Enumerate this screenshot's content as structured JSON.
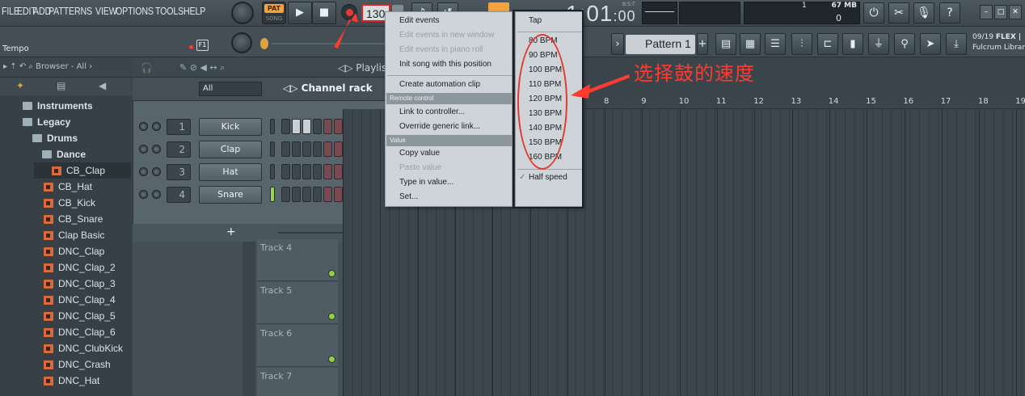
{
  "menu": [
    "FILE",
    "EDIT",
    "ADD",
    "PATTERNS",
    "VIEW",
    "OPTIONS",
    "TOOLS",
    "HELP"
  ],
  "transport": {
    "pat_label": "PAT",
    "song_label": "SONG",
    "play_icon": "play-icon",
    "stop_icon": "stop-icon",
    "tempo_value": "130",
    "time_main": "1:01",
    "time_sub": ":00",
    "bst_label": "B:S:T"
  },
  "memory": {
    "value": "67 MB",
    "count": "1",
    "count2": "0"
  },
  "hint_panel": {
    "date": "09/19",
    "title": "FLEX |",
    "line2": "Fulcrum Librar"
  },
  "bar2": {
    "tempo_label": "Tempo",
    "f1_label": "F1",
    "pattern_label": "Pattern 1"
  },
  "browser": {
    "header": "Browser - All",
    "items": [
      {
        "label": "Instruments",
        "type": "folder"
      },
      {
        "label": "Legacy",
        "type": "folder"
      },
      {
        "label": "Drums",
        "type": "folder"
      },
      {
        "label": "Dance",
        "type": "folder"
      },
      {
        "label": "CB_Clap",
        "type": "audio"
      },
      {
        "label": "CB_Hat",
        "type": "audio"
      },
      {
        "label": "CB_Kick",
        "type": "audio"
      },
      {
        "label": "CB_Snare",
        "type": "audio"
      },
      {
        "label": "Clap Basic",
        "type": "audio"
      },
      {
        "label": "DNC_Clap",
        "type": "audio"
      },
      {
        "label": "DNC_Clap_2",
        "type": "audio"
      },
      {
        "label": "DNC_Clap_3",
        "type": "audio"
      },
      {
        "label": "DNC_Clap_4",
        "type": "audio"
      },
      {
        "label": "DNC_Clap_5",
        "type": "audio"
      },
      {
        "label": "DNC_Clap_6",
        "type": "audio"
      },
      {
        "label": "DNC_ClubKick",
        "type": "audio"
      },
      {
        "label": "DNC_Crash",
        "type": "audio"
      },
      {
        "label": "DNC_Hat",
        "type": "audio"
      }
    ]
  },
  "channel_rack": {
    "title": "Channel rack",
    "filter": "All",
    "playlist_tab": "Playlist",
    "add_label": "+",
    "channels": [
      {
        "num": "1",
        "name": "Kick"
      },
      {
        "num": "2",
        "name": "Clap"
      },
      {
        "num": "3",
        "name": "Hat"
      },
      {
        "num": "4",
        "name": "Snare"
      }
    ]
  },
  "playlist": {
    "ruler": [
      "8",
      "9",
      "10",
      "11",
      "12",
      "13",
      "14",
      "15",
      "16",
      "17",
      "18",
      "19"
    ],
    "tracks": [
      "Track 4",
      "Track 5",
      "Track 6",
      "Track 7"
    ]
  },
  "context_menu": {
    "items": [
      {
        "label": "Edit events",
        "disabled": false
      },
      {
        "label": "Edit events in new window",
        "disabled": true
      },
      {
        "label": "Edit events in piano roll",
        "disabled": true
      },
      {
        "label": "Init song with this position",
        "disabled": false
      },
      {
        "label": "Create automation clip",
        "disabled": false
      }
    ],
    "header_remote": "Remote control",
    "remote_items": [
      {
        "label": "Link to controller...",
        "disabled": false
      },
      {
        "label": "Override generic link...",
        "disabled": false
      }
    ],
    "header_value": "Value",
    "value_items": [
      {
        "label": "Copy value",
        "disabled": false
      },
      {
        "label": "Paste value",
        "disabled": true
      },
      {
        "label": "Type in value...",
        "disabled": false
      },
      {
        "label": "Set...",
        "disabled": false
      }
    ]
  },
  "tempo_submenu": {
    "tap": "Tap",
    "bpms": [
      "80 BPM",
      "90 BPM",
      "100 BPM",
      "110 BPM",
      "120 BPM",
      "130 BPM",
      "140 BPM",
      "150 BPM",
      "160 BPM"
    ],
    "half_speed": "Half speed",
    "check_mark": "✓"
  },
  "annotation": {
    "text": "选择鼓的速度",
    "color": "#ff3b30"
  },
  "colors": {
    "accent": "#f7a23b",
    "record": "#e53935",
    "led": "#8bd14a"
  }
}
